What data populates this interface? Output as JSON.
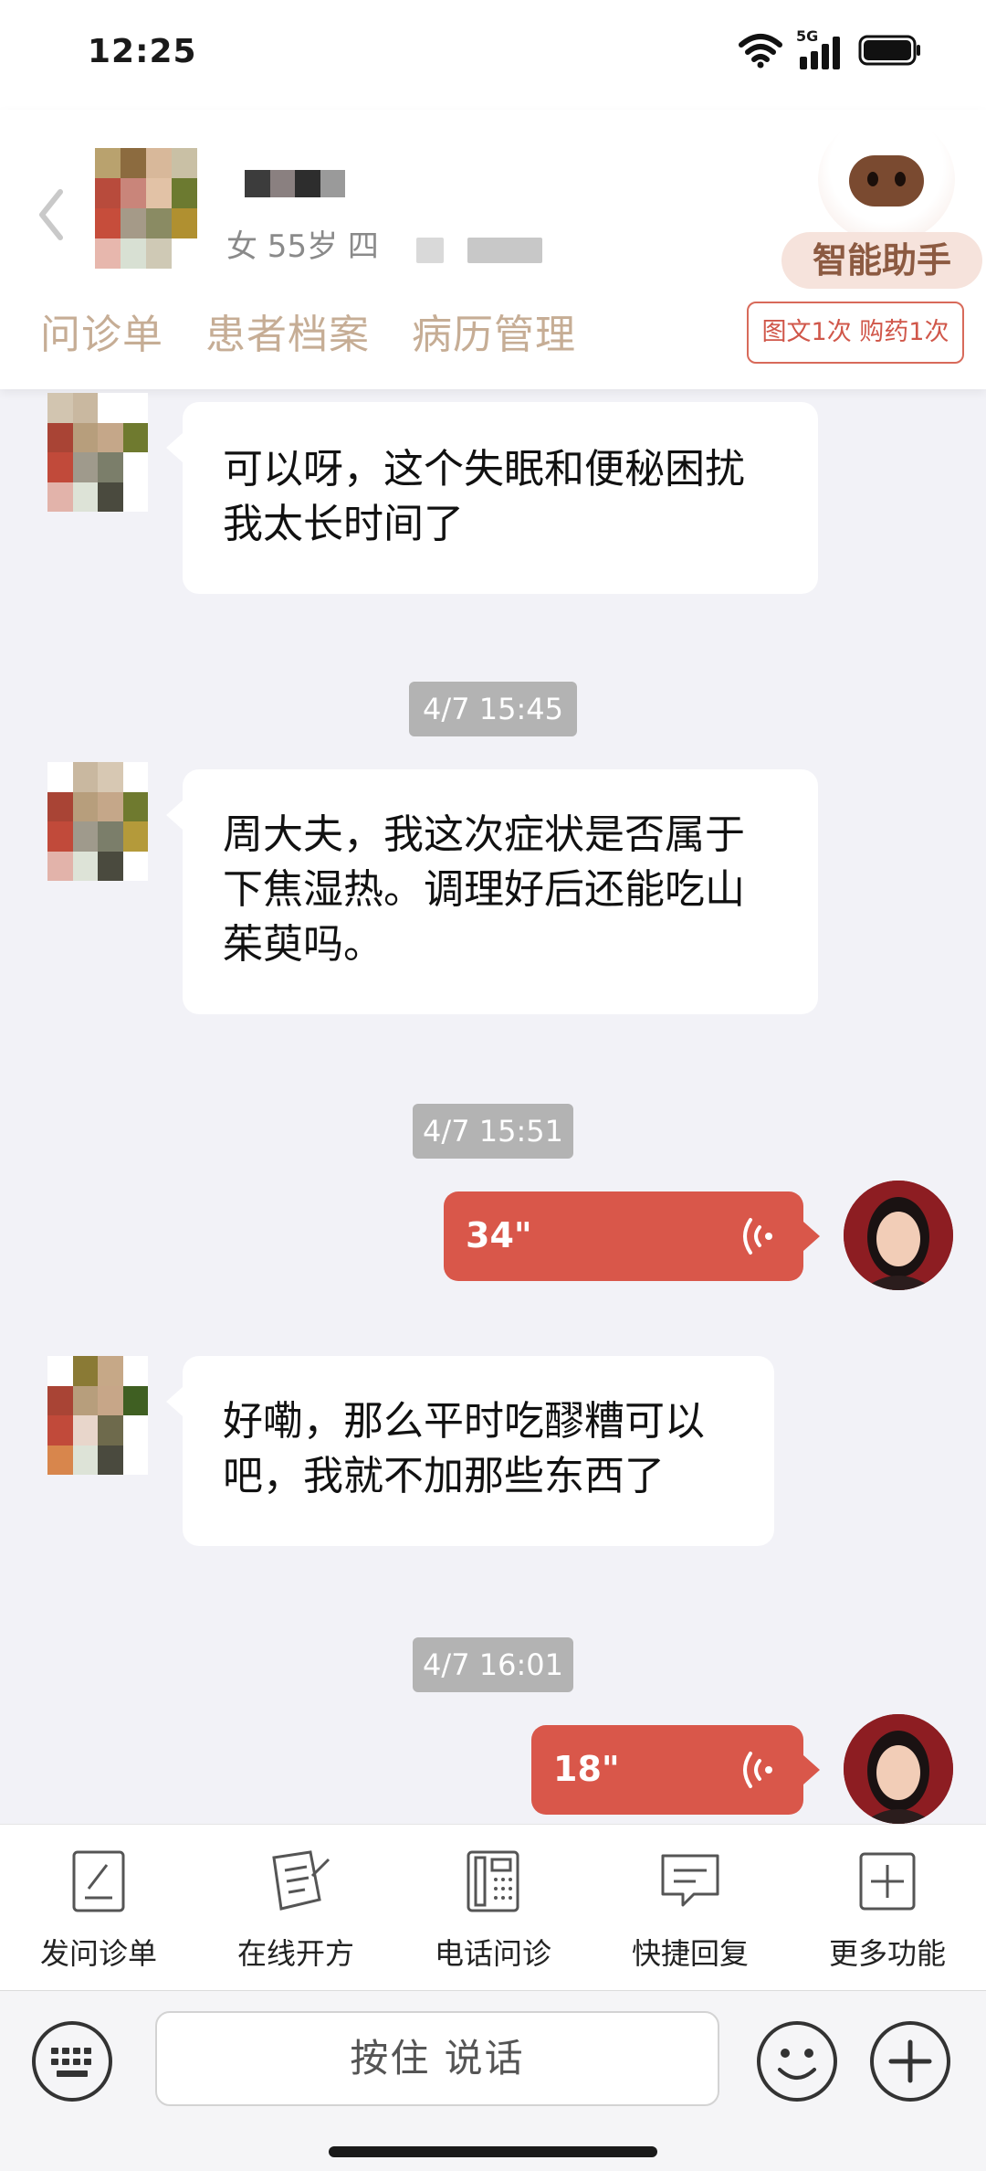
{
  "status_bar": {
    "time": "12:25",
    "network": "5G"
  },
  "header": {
    "patient_info": "女 55岁 四",
    "assistant_label": "智能助手",
    "tabs": [
      "问诊单",
      "患者档案",
      "病历管理"
    ],
    "quota_badge": "图文1次 购药1次"
  },
  "messages": [
    {
      "type": "incoming",
      "text_lines": [
        "可以呀，这个失眠和便秘困扰",
        "我太长时间了"
      ]
    },
    {
      "type": "time",
      "text": "4/7 15:45"
    },
    {
      "type": "incoming",
      "text_lines": [
        "周大夫，我这次症状是否属于",
        "下焦湿热。调理好后还能吃山",
        "茱萸吗。"
      ]
    },
    {
      "type": "time",
      "text": "4/7 15:51"
    },
    {
      "type": "voice",
      "duration": "34\""
    },
    {
      "type": "incoming",
      "text_lines": [
        "好嘞，那么平时吃醪糟可以",
        "吧，我就不加那些东西了"
      ]
    },
    {
      "type": "time",
      "text": "4/7 16:01"
    },
    {
      "type": "voice",
      "duration": "18\""
    }
  ],
  "toolbar": {
    "items": [
      {
        "label": "发问诊单",
        "icon": "form-edit-icon"
      },
      {
        "label": "在线开方",
        "icon": "prescription-icon"
      },
      {
        "label": "电话问诊",
        "icon": "phone-icon"
      },
      {
        "label": "快捷回复",
        "icon": "quick-reply-icon"
      },
      {
        "label": "更多功能",
        "icon": "plus-square-icon"
      }
    ]
  },
  "input": {
    "hold_to_talk": "按住 说话"
  },
  "colors": {
    "accent": "#d9574a",
    "tab_text": "#c6ad95",
    "assistant_text": "#8c5a41"
  }
}
